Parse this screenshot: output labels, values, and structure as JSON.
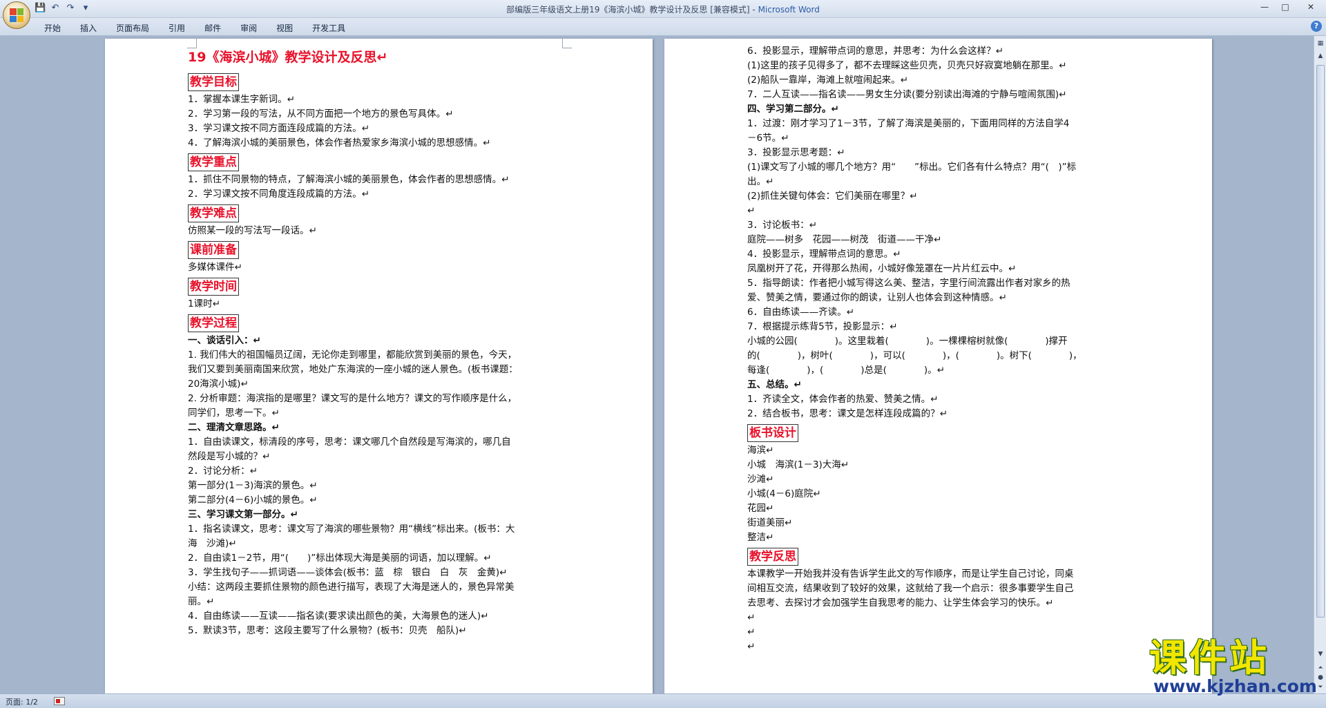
{
  "window": {
    "title_doc": "部编版三年级语文上册19《海滨小城》教学设计及反思 [兼容模式] - ",
    "title_app": "Microsoft Word",
    "minimize": "—",
    "maximize": "□",
    "close": "✕"
  },
  "qat": {
    "save": "💾",
    "undo": "↶",
    "redo": "↷",
    "customize": "▾"
  },
  "ribbon": {
    "tabs": [
      "开始",
      "插入",
      "页面布局",
      "引用",
      "邮件",
      "审阅",
      "视图",
      "开发工具"
    ],
    "help": "?"
  },
  "page1": {
    "lines": [
      {
        "t": "19《海滨小城》教学设计及反思↵",
        "k": "h1"
      },
      {
        "t": "教学目标",
        "k": "boxed"
      },
      {
        "t": "1．掌握本课生字新词。↵"
      },
      {
        "t": "2．学习第一段的写法，从不同方面把一个地方的景色写具体。↵"
      },
      {
        "t": "3．学习课文按不同方面连段成篇的方法。↵"
      },
      {
        "t": "4．了解海滨小城的美丽景色，体会作者热爱家乡海滨小城的思想感情。↵"
      },
      {
        "t": "教学重点",
        "k": "boxed"
      },
      {
        "t": "1．抓住不同景物的特点，了解海滨小城的美丽景色，体会作者的思想感情。↵"
      },
      {
        "t": "2．学习课文按不同角度连段成篇的方法。↵"
      },
      {
        "t": "教学难点",
        "k": "boxed"
      },
      {
        "t": "仿照某一段的写法写一段话。↵"
      },
      {
        "t": "课前准备",
        "k": "boxed"
      },
      {
        "t": "多媒体课件↵"
      },
      {
        "t": "教学时间",
        "k": "boxed"
      },
      {
        "t": "1课时↵"
      },
      {
        "t": "教学过程",
        "k": "boxed"
      },
      {
        "t": "一、谈话引入：↵",
        "k": "bold"
      },
      {
        "t": "1. 我们伟大的祖国幅员辽阔，无论你走到哪里，都能欣赏到美丽的景色，今天，"
      },
      {
        "t": "我们又要到美丽南国来欣赏，地处广东海滨的一座小城的迷人景色。(板书课题："
      },
      {
        "t": "20海滨小城)↵"
      },
      {
        "t": "2. 分析审题：海滨指的是哪里？课文写的是什么地方？课文的写作顺序是什么，"
      },
      {
        "t": "同学们，思考一下。↵"
      },
      {
        "t": "二、理清文章思路。↵",
        "k": "bold"
      },
      {
        "t": "1．自由读课文，标清段的序号，思考：课文哪几个自然段是写海滨的，哪几自"
      },
      {
        "t": "然段是写小城的？↵"
      },
      {
        "t": "2．讨论分析：↵"
      },
      {
        "t": "第一部分(1－3)海滨的景色。↵"
      },
      {
        "t": "第二部分(4－6)小城的景色。↵"
      },
      {
        "t": "三、学习课文第一部分。↵",
        "k": "bold"
      },
      {
        "t": "1．指名读课文，思考：课文写了海滨的哪些景物？用“横线”标出来。(板书：大"
      },
      {
        "t": "海　沙滩)↵"
      },
      {
        "t": "2．自由读1－2节，用“(　　)”标出体现大海是美丽的词语，加以理解。↵"
      },
      {
        "t": "3．学生找句子——抓词语——谈体会(板书：蓝　棕　银白　白　灰　金黄)↵"
      },
      {
        "t": "小结：这两段主要抓住景物的颜色进行描写，表现了大海是迷人的，景色异常美"
      },
      {
        "t": "丽。↵"
      },
      {
        "t": "4．自由练读——互读——指名读(要求读出颜色的美，大海景色的迷人)↵"
      },
      {
        "t": "5．默读3节，思考：这段主要写了什么景物？(板书：贝壳　船队)↵"
      }
    ]
  },
  "page2": {
    "lines": [
      {
        "t": "6．投影显示，理解带点词的意思，并思考：为什么会这样？↵"
      },
      {
        "t": "(1)这里的孩子见得多了，都不去理睬这些贝壳，贝壳只好寂寞地躺在那里。↵"
      },
      {
        "t": "(2)船队一靠岸，海滩上就喧闹起来。↵"
      },
      {
        "t": "7．二人互读——指名读——男女生分读(要分别读出海滩的宁静与喧闹氛围)↵"
      },
      {
        "t": "四、学习第二部分。↵",
        "k": "bold"
      },
      {
        "t": "1．过渡：刚才学习了1－3节，了解了海滨是美丽的，下面用同样的方法自学4"
      },
      {
        "t": "－6节。↵"
      },
      {
        "t": "3．投影显示思考题：↵"
      },
      {
        "t": "(1)课文写了小城的哪几个地方？用“　　”标出。它们各有什么特点？用“(　)”标"
      },
      {
        "t": "出。↵"
      },
      {
        "t": "(2)抓住关键句体会：它们美丽在哪里？↵"
      },
      {
        "t": "↵"
      },
      {
        "t": "3．讨论板书：↵"
      },
      {
        "t": "庭院——树多　花园——树茂　街道——干净↵"
      },
      {
        "t": "4．投影显示，理解带点词的意思。↵"
      },
      {
        "t": "凤凰树开了花，开得那么热闹，小城好像笼罩在一片片红云中。↵"
      },
      {
        "t": "5．指导朗读：作者把小城写得这么美、整洁，字里行间流露出作者对家乡的热"
      },
      {
        "t": "爱、赞美之情，要通过你的朗读，让别人也体会到这种情感。↵"
      },
      {
        "t": "6．自由练读——齐读。↵"
      },
      {
        "t": "7．根据提示练背5节，投影显示：↵"
      },
      {
        "t": "小城的公园(　　　　)。这里栽着(　　　　)。一棵棵榕树就像(　　　　)撑开"
      },
      {
        "t": "的(　　　　)，树叶(　　　　)，可以(　　　　)，(　　　　)。树下(　　　　)，"
      },
      {
        "t": "每逢(　　　　)，(　　　　)总是(　　　　)。↵"
      },
      {
        "t": "五、总结。↵",
        "k": "bold"
      },
      {
        "t": "1．齐读全文，体会作者的热爱、赞美之情。↵"
      },
      {
        "t": "2．结合板书，思考：课文是怎样连段成篇的？↵"
      },
      {
        "t": "板书设计",
        "k": "boxed"
      },
      {
        "t": "海滨↵"
      },
      {
        "t": "小城　海滨(1－3)大海↵"
      },
      {
        "t": "沙滩↵"
      },
      {
        "t": "小城(4－6)庭院↵"
      },
      {
        "t": "花园↵"
      },
      {
        "t": "街道美丽↵"
      },
      {
        "t": "整洁↵"
      },
      {
        "t": "教学反思",
        "k": "boxed"
      },
      {
        "t": "本课教学一开始我并没有告诉学生此文的写作顺序，而是让学生自己讨论，同桌"
      },
      {
        "t": "间相互交流，结果收到了较好的效果，这就给了我一个启示：很多事要学生自己"
      },
      {
        "t": "去思考、去探讨才会加强学生自我思考的能力、让学生体会学习的快乐。↵"
      },
      {
        "t": "↵"
      },
      {
        "t": "↵"
      },
      {
        "t": "↵"
      }
    ]
  },
  "status": {
    "page": "页面: 1/2"
  },
  "watermark": {
    "title": "课件站",
    "url": "www.kjzhan.com"
  },
  "colors": {
    "heading_red": "#e8122b",
    "workspace": "#a4b5cc"
  }
}
